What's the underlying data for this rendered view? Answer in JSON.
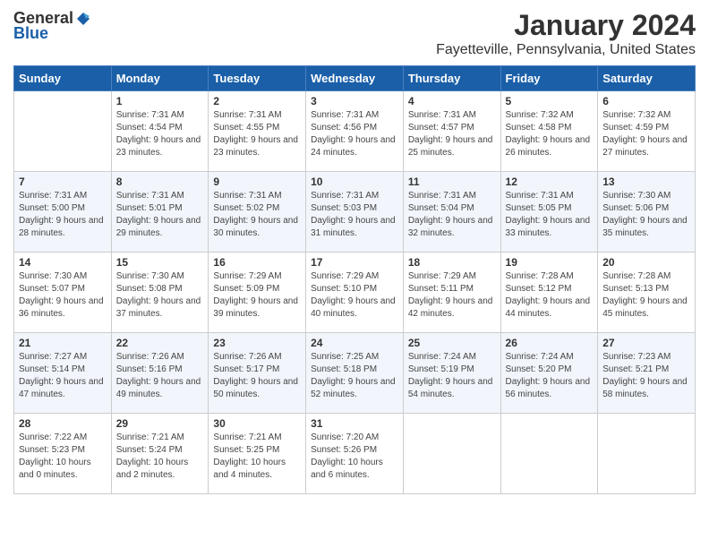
{
  "header": {
    "logo_general": "General",
    "logo_blue": "Blue",
    "month_title": "January 2024",
    "location": "Fayetteville, Pennsylvania, United States"
  },
  "weekdays": [
    "Sunday",
    "Monday",
    "Tuesday",
    "Wednesday",
    "Thursday",
    "Friday",
    "Saturday"
  ],
  "weeks": [
    [
      {
        "day": "",
        "sunrise": "",
        "sunset": "",
        "daylight": ""
      },
      {
        "day": "1",
        "sunrise": "Sunrise: 7:31 AM",
        "sunset": "Sunset: 4:54 PM",
        "daylight": "Daylight: 9 hours and 23 minutes."
      },
      {
        "day": "2",
        "sunrise": "Sunrise: 7:31 AM",
        "sunset": "Sunset: 4:55 PM",
        "daylight": "Daylight: 9 hours and 23 minutes."
      },
      {
        "day": "3",
        "sunrise": "Sunrise: 7:31 AM",
        "sunset": "Sunset: 4:56 PM",
        "daylight": "Daylight: 9 hours and 24 minutes."
      },
      {
        "day": "4",
        "sunrise": "Sunrise: 7:31 AM",
        "sunset": "Sunset: 4:57 PM",
        "daylight": "Daylight: 9 hours and 25 minutes."
      },
      {
        "day": "5",
        "sunrise": "Sunrise: 7:32 AM",
        "sunset": "Sunset: 4:58 PM",
        "daylight": "Daylight: 9 hours and 26 minutes."
      },
      {
        "day": "6",
        "sunrise": "Sunrise: 7:32 AM",
        "sunset": "Sunset: 4:59 PM",
        "daylight": "Daylight: 9 hours and 27 minutes."
      }
    ],
    [
      {
        "day": "7",
        "sunrise": "Sunrise: 7:31 AM",
        "sunset": "Sunset: 5:00 PM",
        "daylight": "Daylight: 9 hours and 28 minutes."
      },
      {
        "day": "8",
        "sunrise": "Sunrise: 7:31 AM",
        "sunset": "Sunset: 5:01 PM",
        "daylight": "Daylight: 9 hours and 29 minutes."
      },
      {
        "day": "9",
        "sunrise": "Sunrise: 7:31 AM",
        "sunset": "Sunset: 5:02 PM",
        "daylight": "Daylight: 9 hours and 30 minutes."
      },
      {
        "day": "10",
        "sunrise": "Sunrise: 7:31 AM",
        "sunset": "Sunset: 5:03 PM",
        "daylight": "Daylight: 9 hours and 31 minutes."
      },
      {
        "day": "11",
        "sunrise": "Sunrise: 7:31 AM",
        "sunset": "Sunset: 5:04 PM",
        "daylight": "Daylight: 9 hours and 32 minutes."
      },
      {
        "day": "12",
        "sunrise": "Sunrise: 7:31 AM",
        "sunset": "Sunset: 5:05 PM",
        "daylight": "Daylight: 9 hours and 33 minutes."
      },
      {
        "day": "13",
        "sunrise": "Sunrise: 7:30 AM",
        "sunset": "Sunset: 5:06 PM",
        "daylight": "Daylight: 9 hours and 35 minutes."
      }
    ],
    [
      {
        "day": "14",
        "sunrise": "Sunrise: 7:30 AM",
        "sunset": "Sunset: 5:07 PM",
        "daylight": "Daylight: 9 hours and 36 minutes."
      },
      {
        "day": "15",
        "sunrise": "Sunrise: 7:30 AM",
        "sunset": "Sunset: 5:08 PM",
        "daylight": "Daylight: 9 hours and 37 minutes."
      },
      {
        "day": "16",
        "sunrise": "Sunrise: 7:29 AM",
        "sunset": "Sunset: 5:09 PM",
        "daylight": "Daylight: 9 hours and 39 minutes."
      },
      {
        "day": "17",
        "sunrise": "Sunrise: 7:29 AM",
        "sunset": "Sunset: 5:10 PM",
        "daylight": "Daylight: 9 hours and 40 minutes."
      },
      {
        "day": "18",
        "sunrise": "Sunrise: 7:29 AM",
        "sunset": "Sunset: 5:11 PM",
        "daylight": "Daylight: 9 hours and 42 minutes."
      },
      {
        "day": "19",
        "sunrise": "Sunrise: 7:28 AM",
        "sunset": "Sunset: 5:12 PM",
        "daylight": "Daylight: 9 hours and 44 minutes."
      },
      {
        "day": "20",
        "sunrise": "Sunrise: 7:28 AM",
        "sunset": "Sunset: 5:13 PM",
        "daylight": "Daylight: 9 hours and 45 minutes."
      }
    ],
    [
      {
        "day": "21",
        "sunrise": "Sunrise: 7:27 AM",
        "sunset": "Sunset: 5:14 PM",
        "daylight": "Daylight: 9 hours and 47 minutes."
      },
      {
        "day": "22",
        "sunrise": "Sunrise: 7:26 AM",
        "sunset": "Sunset: 5:16 PM",
        "daylight": "Daylight: 9 hours and 49 minutes."
      },
      {
        "day": "23",
        "sunrise": "Sunrise: 7:26 AM",
        "sunset": "Sunset: 5:17 PM",
        "daylight": "Daylight: 9 hours and 50 minutes."
      },
      {
        "day": "24",
        "sunrise": "Sunrise: 7:25 AM",
        "sunset": "Sunset: 5:18 PM",
        "daylight": "Daylight: 9 hours and 52 minutes."
      },
      {
        "day": "25",
        "sunrise": "Sunrise: 7:24 AM",
        "sunset": "Sunset: 5:19 PM",
        "daylight": "Daylight: 9 hours and 54 minutes."
      },
      {
        "day": "26",
        "sunrise": "Sunrise: 7:24 AM",
        "sunset": "Sunset: 5:20 PM",
        "daylight": "Daylight: 9 hours and 56 minutes."
      },
      {
        "day": "27",
        "sunrise": "Sunrise: 7:23 AM",
        "sunset": "Sunset: 5:21 PM",
        "daylight": "Daylight: 9 hours and 58 minutes."
      }
    ],
    [
      {
        "day": "28",
        "sunrise": "Sunrise: 7:22 AM",
        "sunset": "Sunset: 5:23 PM",
        "daylight": "Daylight: 10 hours and 0 minutes."
      },
      {
        "day": "29",
        "sunrise": "Sunrise: 7:21 AM",
        "sunset": "Sunset: 5:24 PM",
        "daylight": "Daylight: 10 hours and 2 minutes."
      },
      {
        "day": "30",
        "sunrise": "Sunrise: 7:21 AM",
        "sunset": "Sunset: 5:25 PM",
        "daylight": "Daylight: 10 hours and 4 minutes."
      },
      {
        "day": "31",
        "sunrise": "Sunrise: 7:20 AM",
        "sunset": "Sunset: 5:26 PM",
        "daylight": "Daylight: 10 hours and 6 minutes."
      },
      {
        "day": "",
        "sunrise": "",
        "sunset": "",
        "daylight": ""
      },
      {
        "day": "",
        "sunrise": "",
        "sunset": "",
        "daylight": ""
      },
      {
        "day": "",
        "sunrise": "",
        "sunset": "",
        "daylight": ""
      }
    ]
  ]
}
